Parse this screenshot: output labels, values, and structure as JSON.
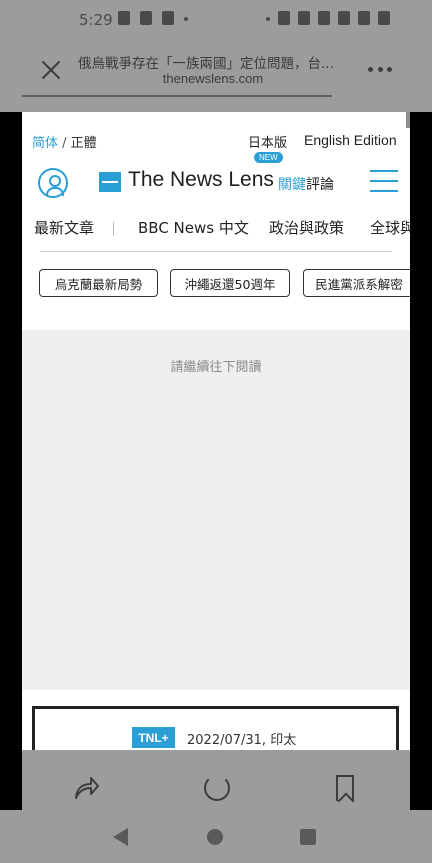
{
  "status_bar": {
    "time": "5:29"
  },
  "toolbar": {
    "title": "俄烏戰爭存在「一族兩國」定位問題，台...",
    "url": "thenewslens.com"
  },
  "top_links": {
    "simplified": "简体",
    "separator": " / ",
    "traditional": "正體",
    "japan_edition": "日本版",
    "english_edition": "English Edition"
  },
  "logo": {
    "text": "The News Lens",
    "sub_accent": "關鍵",
    "sub_rest": "評論",
    "new_badge": "NEW"
  },
  "nav": {
    "items": [
      "最新文章",
      "BBC News 中文",
      "政治與政策",
      "全球與"
    ]
  },
  "tags": [
    "烏克蘭最新局勢",
    "沖繩返還50週年",
    "民進黨派系解密"
  ],
  "content": {
    "continue_reading": "請繼續往下閱讀"
  },
  "card": {
    "badge": "TNL+",
    "meta": "2022/07/31, 印太"
  },
  "icons": {
    "close": "close-icon",
    "more": "more-vertical-icon",
    "user": "user-icon",
    "menu": "menu-icon",
    "share": "share-icon",
    "refresh": "refresh-icon",
    "bookmark": "bookmark-icon"
  },
  "colors": {
    "accent": "#2a9fd6",
    "dim_overlay": "#9c9c9c"
  }
}
